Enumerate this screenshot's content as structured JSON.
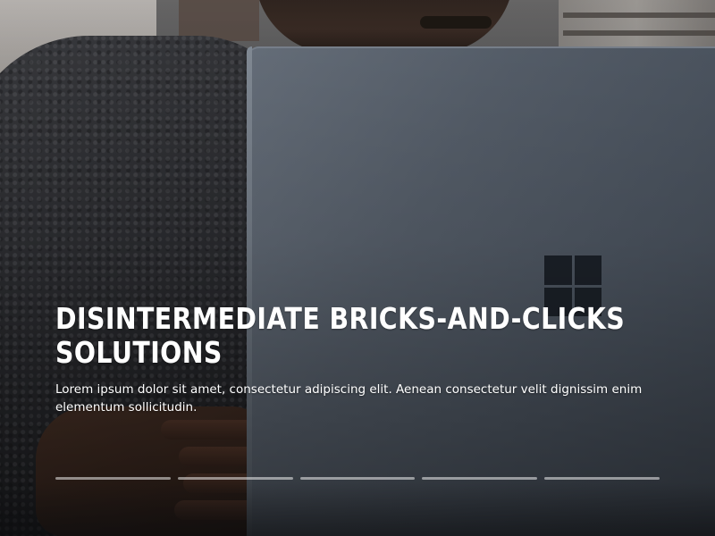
{
  "slide": {
    "title": "Disintermediate bricks-and-clicks solutions",
    "description": "Lorem ipsum dolor sit amet, consectetur adipiscing elit. Aenean consectetur velit dignissim enim elementum sollicitudin."
  },
  "pager": {
    "total": 5,
    "active_index": 1
  },
  "icons": {
    "laptop_logo": "windows-logo-icon"
  }
}
